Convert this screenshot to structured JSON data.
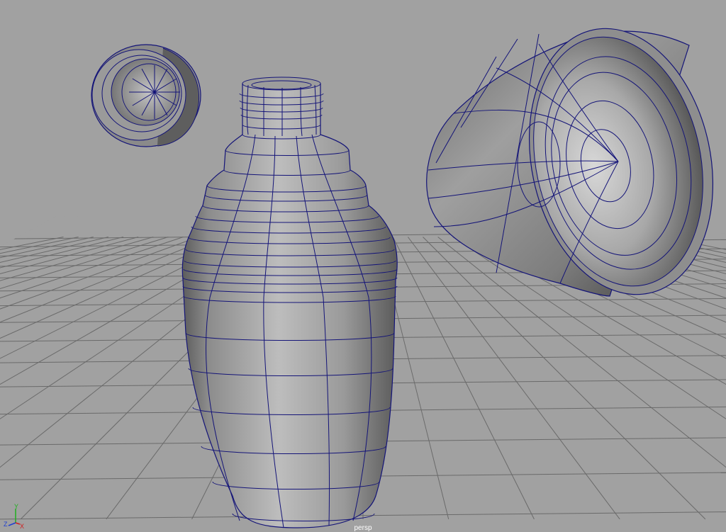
{
  "viewport": {
    "camera_label": "persp",
    "axis_labels": {
      "y": "Y",
      "z": "Z",
      "x": "X"
    },
    "colors": {
      "background": "#a1a1a1",
      "grid": "#6a6a6a",
      "wireframe": "#141478",
      "axis_x": "#d02020",
      "axis_y": "#20b020",
      "axis_z": "#2040d0"
    },
    "objects": [
      "bottle-body",
      "bottle-cap",
      "cup"
    ]
  }
}
